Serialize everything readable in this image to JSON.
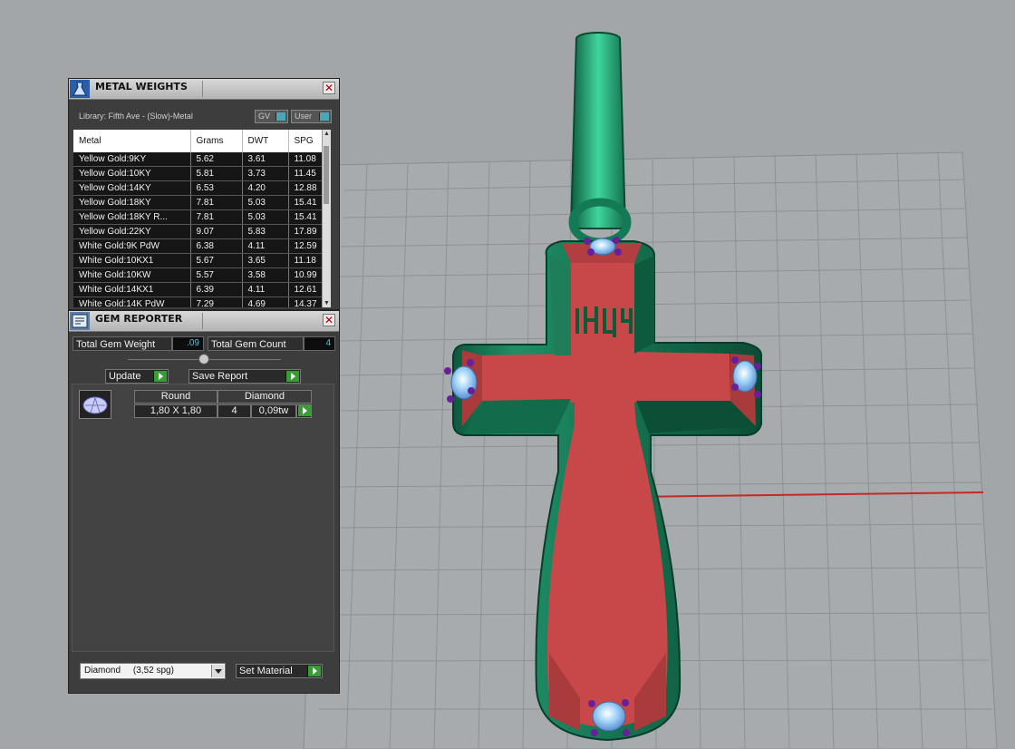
{
  "metal_weights": {
    "title": "METAL WEIGHTS",
    "library_label": "Library: Fifth Ave - (Slow)-Metal",
    "toggle_gv": "GV",
    "toggle_user": "User",
    "columns": [
      "Metal",
      "Grams",
      "DWT",
      "SPG"
    ],
    "rows": [
      [
        "Yellow Gold:9KY",
        "5.62",
        "3.61",
        "11.08"
      ],
      [
        "Yellow Gold:10KY",
        "5.81",
        "3.73",
        "11.45"
      ],
      [
        "Yellow Gold:14KY",
        "6.53",
        "4.20",
        "12.88"
      ],
      [
        "Yellow Gold:18KY",
        "7.81",
        "5.03",
        "15.41"
      ],
      [
        "Yellow Gold:18KY R...",
        "7.81",
        "5.03",
        "15.41"
      ],
      [
        "Yellow Gold:22KY",
        "9.07",
        "5.83",
        "17.89"
      ],
      [
        "White Gold:9K PdW",
        "6.38",
        "4.11",
        "12.59"
      ],
      [
        "White Gold:10KX1",
        "5.67",
        "3.65",
        "11.18"
      ],
      [
        "White Gold:10KW",
        "5.57",
        "3.58",
        "10.99"
      ],
      [
        "White Gold:14KX1",
        "6.39",
        "4.11",
        "12.61"
      ],
      [
        "White Gold:14K PdW",
        "7.29",
        "4.69",
        "14.37"
      ]
    ]
  },
  "gem_reporter": {
    "title": "GEM REPORTER",
    "total_weight_label": "Total Gem Weight",
    "total_weight_value": ".09",
    "total_count_label": "Total Gem Count",
    "total_count_value": "4",
    "update_label": "Update",
    "save_report_label": "Save Report",
    "gem": {
      "shape": "Round",
      "material": "Diamond",
      "size": "1,80 X 1,80",
      "count": "4",
      "weight": "0,09tw"
    },
    "material_select": "Diamond     (3,52 spg)",
    "set_material_label": "Set Material"
  },
  "colors": {
    "metal_green": "#1a7a58",
    "face_red": "#c8484a",
    "gem_blue": "#8fc8f2",
    "prong_purple": "#6a1f9a",
    "axis_red": "#c42a24"
  }
}
